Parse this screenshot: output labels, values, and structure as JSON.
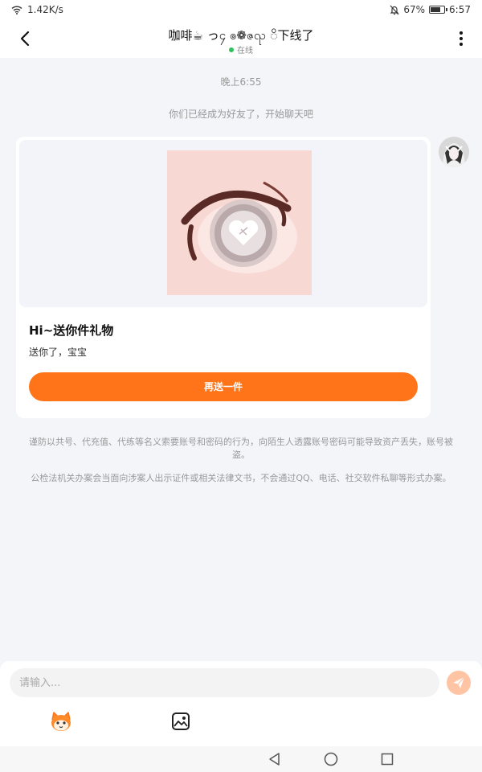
{
  "status_bar": {
    "net_speed": "1.42K/s",
    "battery": "67%",
    "battery_level": 0.67,
    "time": "6:57"
  },
  "header": {
    "title": "咖啡☕ っ၄ ၜ❁ဇၺ ိ下线了",
    "status": "在线"
  },
  "chat": {
    "time_label": "晚上6:55",
    "system_message": "你们已经成为好友了，开始聊天吧",
    "gift_card": {
      "title": "Hi~送你件礼物",
      "description": "送你了，宝宝",
      "button_label": "再送一件"
    },
    "warnings": [
      "谨防以共号、代充值、代练等名义索要账号和密码的行为，向陌生人透露账号密码可能导致资产丢失，账号被盗。",
      "公检法机关办案会当面向涉案人出示证件或相关法律文书，不会通过QQ、电话、社交软件私聊等形式办案。"
    ]
  },
  "input": {
    "placeholder": "请输入..."
  },
  "colors": {
    "accent": "#ff7419",
    "online": "#2fc25b",
    "send_disabled": "#ffc4a3",
    "background": "#f4f5f9"
  },
  "icons": {
    "back": "chevron-left-icon",
    "more": "more-vertical-icon",
    "send": "send-icon",
    "emoji": "emoji-icon",
    "image": "image-icon"
  }
}
